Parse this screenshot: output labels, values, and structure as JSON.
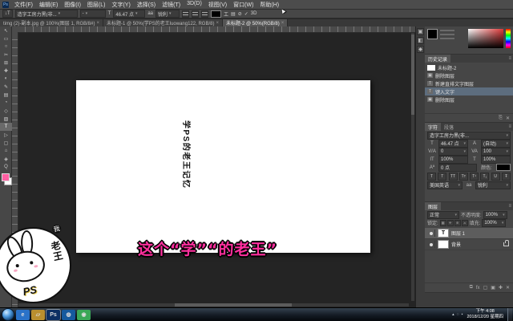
{
  "menu_bar": {
    "items": [
      "文件(F)",
      "编辑(E)",
      "图像(I)",
      "图层(L)",
      "文字(Y)",
      "选择(S)",
      "滤镜(T)",
      "3D(D)",
      "视图(V)",
      "窗口(W)",
      "帮助(H)"
    ]
  },
  "options_bar": {
    "tool_icon": "↓T",
    "font_family": "造字工房力黑(非...",
    "font_style": "-",
    "size_icon": "T",
    "size_value": "46.47 点",
    "aa_icon": "aa",
    "aa_value": "锐利",
    "cancel_icon": "⊘",
    "commit_icon": "✓",
    "threed_label": "3D"
  },
  "document_tabs": [
    {
      "label": "timg (2)-副本.jpg @ 100%(图层 1, RGB/8#)",
      "close": "×",
      "active": false
    },
    {
      "label": "未标题-1 @ 50%(学PS的老王luowang122, RGB/8)",
      "close": "×",
      "active": false
    },
    {
      "label": "未标题-2 @ 50%(RGB/8)",
      "close": "×",
      "active": true
    }
  ],
  "tool_bar": {
    "tools": [
      {
        "glyph": "↖"
      },
      {
        "glyph": "▭"
      },
      {
        "glyph": "○"
      },
      {
        "glyph": "✂"
      },
      {
        "glyph": "⊞"
      },
      {
        "glyph": "✚"
      },
      {
        "glyph": "◐"
      },
      {
        "glyph": "✎"
      },
      {
        "glyph": "▤"
      },
      {
        "glyph": "◔"
      },
      {
        "glyph": "◇"
      },
      {
        "glyph": "▨"
      },
      {
        "glyph": "T",
        "active": true
      },
      {
        "glyph": "▷"
      },
      {
        "glyph": "▢"
      },
      {
        "glyph": "⌂"
      },
      {
        "glyph": "◈"
      },
      {
        "glyph": "Q"
      }
    ],
    "foreground_color": "#ff5fa2",
    "background_color": "#ffffff"
  },
  "canvas": {
    "vertical_text": "学PS的老王记忆"
  },
  "subtitle": {
    "text": "这个“学”“的老王”",
    "color": "#ff2f9e"
  },
  "logo": {
    "ps_text": "PS",
    "name_text": "老王",
    "side_text": "我"
  },
  "dock_icons": [
    "▣",
    "◧",
    "◆"
  ],
  "panels": {
    "color": {
      "field_color": "#e03a3a"
    },
    "history": {
      "title": "历史记录",
      "items": [
        {
          "icon": "",
          "label": "未标题-2",
          "snapshot": true
        },
        {
          "icon": "▣",
          "label": "删除图层"
        },
        {
          "icon": "T",
          "label": "新建直排文字图层"
        },
        {
          "icon": "T",
          "label": "键入文字",
          "selected": true
        },
        {
          "icon": "▣",
          "label": "删除图层"
        }
      ],
      "footer_icons": [
        "⎘",
        "✕"
      ]
    },
    "character": {
      "tab_character": "字符",
      "tab_paragraph": "段落",
      "font": "造字工房力黑(非...",
      "size_icon": "T",
      "size": "46.47 点",
      "leading_icon": "A",
      "leading": "(自动)",
      "kerning_icon": "V/A",
      "kerning": "0",
      "tracking_icon": "VA",
      "tracking": "100",
      "vscale_icon": "IT",
      "vscale": "100%",
      "hscale_icon": "T",
      "hscale": "100%",
      "baseline_icon": "Aª",
      "baseline": "0 点",
      "color_label": "颜色:",
      "color": "#000000",
      "style_buttons": [
        "T",
        "T",
        "TT",
        "Tт",
        "T¹",
        "T₁",
        "U",
        "Ŧ"
      ],
      "language": "美国英语",
      "aa_icon": "aa",
      "aa": "锐利"
    },
    "layers": {
      "tab": "图层",
      "blend_mode": "正常",
      "opacity_label": "不透明度:",
      "opacity": "100%",
      "lock_label": "锁定:",
      "lock_icons": [
        "▦",
        "✛",
        "⊕",
        "a"
      ],
      "fill_label": "填充:",
      "fill": "100%",
      "rows": [
        {
          "name": "图层 1",
          "thumb_text": "T",
          "thumb_bg": "#ffffff",
          "selected": true
        },
        {
          "name": "背景",
          "thumb_text": "",
          "thumb_bg": "#ffffff",
          "locked": true
        }
      ],
      "footer_icons": [
        "⧉",
        "fx",
        "▢",
        "▣",
        "✚",
        "✕"
      ]
    }
  },
  "taskbar": {
    "icons": [
      {
        "glyph": "e",
        "bg": "#2a72c8",
        "color": "#ffffff"
      },
      {
        "glyph": "▱",
        "bg": "#b98f2f",
        "color": "#ffe9a8"
      },
      {
        "glyph": "Ps",
        "bg": "#0c2f63",
        "color": "#aacdf2",
        "active": true
      },
      {
        "glyph": "◍",
        "bg": "#155a9e",
        "color": "#d8eaf9"
      },
      {
        "glyph": "◉",
        "bg": "#3aa757",
        "color": "#ffffff"
      }
    ],
    "tray_icons": [
      "▴",
      "◌",
      "▪"
    ],
    "tray": {
      "time": "下午 4:08",
      "date": "2018/12/20 星期四"
    }
  }
}
